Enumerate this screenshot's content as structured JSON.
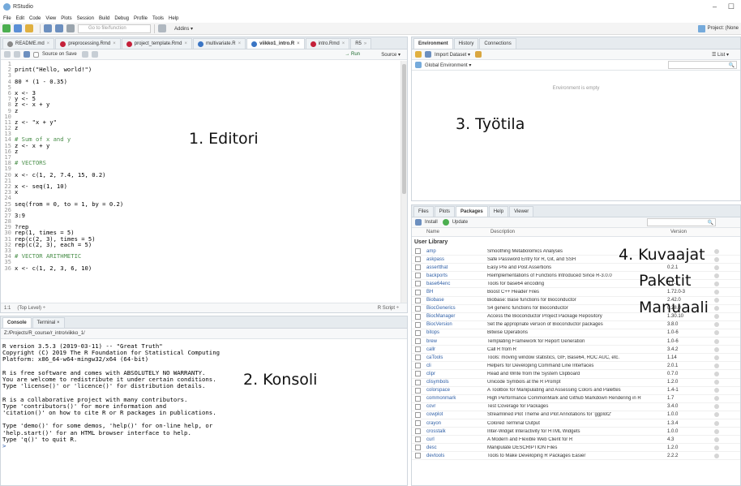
{
  "app": {
    "title": "RStudio",
    "min_glyph": "–",
    "max_glyph": "☐"
  },
  "menu": [
    "File",
    "Edit",
    "Code",
    "View",
    "Plots",
    "Session",
    "Build",
    "Debug",
    "Profile",
    "Tools",
    "Help"
  ],
  "toolbar": {
    "goto_placeholder": "Go to file/function",
    "addins_label": "Addins ▾",
    "project_label": "Project: (None"
  },
  "editor": {
    "tabs": [
      {
        "label": "README.md",
        "color": "#6a6a6a",
        "active": false
      },
      {
        "label": "preprocessing.Rmd",
        "color": "#c4203a",
        "active": false
      },
      {
        "label": "project_template.Rmd",
        "color": "#c4203a",
        "active": false
      },
      {
        "label": "multivariate.R",
        "color": "#3a75c4",
        "active": false
      },
      {
        "label": "viikko1_intro.R",
        "color": "#3a75c4",
        "active": true
      },
      {
        "label": "intro.Rmd",
        "color": "#c4203a",
        "active": false
      },
      {
        "label": "R5",
        "color": "#3a75c4",
        "active": false
      }
    ],
    "source_on_save": "Source on Save",
    "run_label": "→ Run",
    "source_label": "Source ▾",
    "status_pos": "1:1",
    "status_level": "(Top Level) ÷",
    "status_type": "R Script ÷",
    "lines": [
      {
        "n": "1",
        "t": "",
        "c": false
      },
      {
        "n": "2",
        "t": "print(\"Hello, world!\")",
        "c": false
      },
      {
        "n": "3",
        "t": "",
        "c": false
      },
      {
        "n": "4",
        "t": "80 * (1 - 0.35)",
        "c": false
      },
      {
        "n": "5",
        "t": "",
        "c": false
      },
      {
        "n": "6",
        "t": "x <- 3",
        "c": false
      },
      {
        "n": "7",
        "t": "y <- 5",
        "c": false
      },
      {
        "n": "8",
        "t": "z <- x + y",
        "c": false
      },
      {
        "n": "9",
        "t": "z",
        "c": false
      },
      {
        "n": "10",
        "t": "",
        "c": false
      },
      {
        "n": "11",
        "t": "z <- \"x + y\"",
        "c": false
      },
      {
        "n": "12",
        "t": "z",
        "c": false
      },
      {
        "n": "13",
        "t": "",
        "c": false
      },
      {
        "n": "14",
        "t": "# Sum of x and y",
        "c": true
      },
      {
        "n": "15",
        "t": "z <- x + y",
        "c": false
      },
      {
        "n": "16",
        "t": "z",
        "c": false
      },
      {
        "n": "17",
        "t": "",
        "c": false
      },
      {
        "n": "18",
        "t": "# VECTORS",
        "c": true
      },
      {
        "n": "19",
        "t": "",
        "c": false
      },
      {
        "n": "20",
        "t": "x <- c(1, 2, 7.4, 15, 0.2)",
        "c": false
      },
      {
        "n": "21",
        "t": "",
        "c": false
      },
      {
        "n": "22",
        "t": "x <- seq(1, 10)",
        "c": false
      },
      {
        "n": "23",
        "t": "x",
        "c": false
      },
      {
        "n": "24",
        "t": "",
        "c": false
      },
      {
        "n": "25",
        "t": "seq(from = 0, to = 1, by = 0.2)",
        "c": false
      },
      {
        "n": "26",
        "t": "",
        "c": false
      },
      {
        "n": "27",
        "t": "3:9",
        "c": false
      },
      {
        "n": "28",
        "t": "",
        "c": false
      },
      {
        "n": "29",
        "t": "?rep",
        "c": false
      },
      {
        "n": "30",
        "t": "rep(1, times = 5)",
        "c": false
      },
      {
        "n": "31",
        "t": "rep(c(2, 3), times = 5)",
        "c": false
      },
      {
        "n": "32",
        "t": "rep(c(2, 3), each = 5)",
        "c": false
      },
      {
        "n": "33",
        "t": "",
        "c": false
      },
      {
        "n": "34",
        "t": "# VECTOR ARITHMETIC",
        "c": true
      },
      {
        "n": "35",
        "t": "",
        "c": false
      },
      {
        "n": "36",
        "t": "x <- c(1, 2, 3, 6, 10)",
        "c": false
      }
    ]
  },
  "console": {
    "tabs": [
      "Console",
      "Terminal ×"
    ],
    "path": "Z:/Projects/R_course/r_intro/viikko_1/",
    "text": "R version 3.5.3 (2019-03-11) -- \"Great Truth\"\nCopyright (C) 2019 The R Foundation for Statistical Computing\nPlatform: x86_64-w64-mingw32/x64 (64-bit)\n\nR is free software and comes with ABSOLUTELY NO WARRANTY.\nYou are welcome to redistribute it under certain conditions.\nType 'license()' or 'licence()' for distribution details.\n\nR is a collaborative project with many contributors.\nType 'contributors()' for more information and\n'citation()' on how to cite R or R packages in publications.\n\nType 'demo()' for some demos, 'help()' for on-line help, or\n'help.start()' for an HTML browser interface to help.\nType 'q()' to quit R.\n",
    "prompt": ">"
  },
  "environment": {
    "tabs": [
      "Environment",
      "History",
      "Connections"
    ],
    "import_label": "Import Dataset ▾",
    "list_label": "☰ List ▾",
    "scope_label": "Global Environment ▾",
    "empty_text": "Environment is empty"
  },
  "files": {
    "tabs": [
      "Files",
      "Plots",
      "Packages",
      "Help",
      "Viewer"
    ],
    "install_label": "Install",
    "update_label": "Update",
    "columns": [
      "Name",
      "Description",
      "Version"
    ],
    "group": "User Library",
    "packages": [
      {
        "name": "amp",
        "desc": "Smoothing Metabolomics Analyses",
        "ver": ""
      },
      {
        "name": "askpass",
        "desc": "Safe Password Entry for R, Git, and SSH",
        "ver": ""
      },
      {
        "name": "assertthat",
        "desc": "Easy Pre and Post Assertions",
        "ver": "0.2.1"
      },
      {
        "name": "backports",
        "desc": "Reimplementations of Functions Introduced Since R-3.0.0",
        "ver": ""
      },
      {
        "name": "base64enc",
        "desc": "Tools for base64 encoding",
        "ver": "0.1-3"
      },
      {
        "name": "BH",
        "desc": "Boost C++ Header Files",
        "ver": "1.72.0-3"
      },
      {
        "name": "Biobase",
        "desc": "Biobase: Base functions for Bioconductor",
        "ver": "2.42.0"
      },
      {
        "name": "BiocGenerics",
        "desc": "S4 generic functions for Bioconductor",
        "ver": "0.28.0"
      },
      {
        "name": "BiocManager",
        "desc": "Access the Bioconductor Project Package Repository",
        "ver": "1.30.10"
      },
      {
        "name": "BiocVersion",
        "desc": "Set the appropriate version of Bioconductor packages",
        "ver": "3.8.0"
      },
      {
        "name": "bitops",
        "desc": "Bitwise Operations",
        "ver": "1.0-6"
      },
      {
        "name": "brew",
        "desc": "Templating Framework for Report Generation",
        "ver": "1.0-6"
      },
      {
        "name": "callr",
        "desc": "Call R from R",
        "ver": "3.4.2"
      },
      {
        "name": "caTools",
        "desc": "Tools: moving window statistics, GIF, Base64, ROC AUC, etc.",
        "ver": "1.14"
      },
      {
        "name": "cli",
        "desc": "Helpers for Developing Command Line Interfaces",
        "ver": "2.0.1"
      },
      {
        "name": "clipr",
        "desc": "Read and Write from the System Clipboard",
        "ver": "0.7.0"
      },
      {
        "name": "clisymbols",
        "desc": "Unicode Symbols at the R Prompt",
        "ver": "1.2.0"
      },
      {
        "name": "colorspace",
        "desc": "A Toolbox for Manipulating and Assessing Colors and Palettes",
        "ver": "1.4-1"
      },
      {
        "name": "commonmark",
        "desc": "High Performance CommonMark and Github Markdown Rendering in R",
        "ver": "1.7"
      },
      {
        "name": "covr",
        "desc": "Test Coverage for Packages",
        "ver": "3.4.0"
      },
      {
        "name": "cowplot",
        "desc": "Streamlined Plot Theme and Plot Annotations for 'ggplot2'",
        "ver": "1.0.0"
      },
      {
        "name": "crayon",
        "desc": "Colored Terminal Output",
        "ver": "1.3.4"
      },
      {
        "name": "crosstalk",
        "desc": "Inter-Widget Interactivity for HTML Widgets",
        "ver": "1.0.0"
      },
      {
        "name": "curl",
        "desc": "A Modern and Flexible Web Client for R",
        "ver": "4.3"
      },
      {
        "name": "desc",
        "desc": "Manipulate DESCRIPTION Files",
        "ver": "1.2.0"
      },
      {
        "name": "devtools",
        "desc": "Tools to Make Developing R Packages Easier",
        "ver": "2.2.2"
      }
    ]
  },
  "annotations": {
    "editor": "1. Editori",
    "console": "2. Konsoli",
    "workspace": "3. Työtila",
    "packages_line1": "4. Kuvaajat",
    "packages_line2": "Paketit",
    "packages_line3": "Manuaali"
  }
}
